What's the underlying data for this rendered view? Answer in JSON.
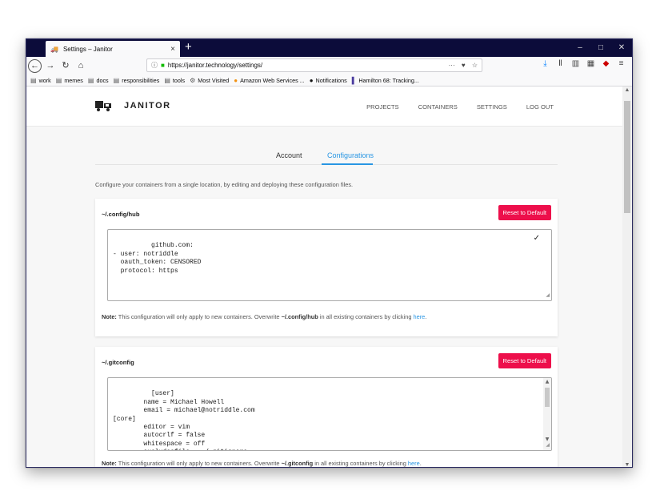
{
  "browser": {
    "tab_title": "Settings – Janitor",
    "tab_close": "×",
    "new_tab": "+",
    "window_controls": [
      "–",
      "□",
      "✕"
    ],
    "url": "https://janitor.technology/settings/",
    "url_actions": [
      "···",
      "♥",
      "☆"
    ],
    "bookmarks": [
      {
        "label": "work",
        "icon": "folder-icon"
      },
      {
        "label": "memes",
        "icon": "folder-icon"
      },
      {
        "label": "docs",
        "icon": "folder-icon"
      },
      {
        "label": "responsibilities",
        "icon": "folder-icon"
      },
      {
        "label": "tools",
        "icon": "folder-icon"
      },
      {
        "label": "Most Visited",
        "icon": "gear-icon"
      },
      {
        "label": "Amazon Web Services ...",
        "icon": "amazon-icon"
      },
      {
        "label": "Notifications",
        "icon": "github-icon"
      },
      {
        "label": "Hamilton 68: Tracking...",
        "icon": "hamilton-icon"
      }
    ]
  },
  "app": {
    "brand": "JANITOR",
    "nav": [
      "PROJECTS",
      "CONTAINERS",
      "SETTINGS",
      "LOG OUT"
    ]
  },
  "settings": {
    "tabs": [
      "Account",
      "Configurations"
    ],
    "active_tab": "Configurations",
    "intro": "Configure your containers from a single location, by editing and deploying these configuration files."
  },
  "configs": [
    {
      "title": "~/.config/hub",
      "reset_label": "Reset to Default",
      "content": "github.com:\n- user: notriddle\n  oauth_token: CENSORED\n  protocol: https",
      "note_prefix": "Note:",
      "note_text": " This configuration will only apply to new containers. Overwrite ",
      "note_path": "~/.config/hub",
      "note_suffix": " in all existing containers by clicking ",
      "note_link": "here",
      "note_end": "."
    },
    {
      "title": "~/.gitconfig",
      "reset_label": "Reset to Default",
      "content": "[user]\n        name = Michael Howell\n        email = michael@notriddle.com\n[core]\n        editor = vim\n        autocrlf = false\n        whitespace = off\n        excludesfile = ~/.gitignore",
      "note_prefix": "Note:",
      "note_text": " This configuration will only apply to new containers. Overwrite ",
      "note_path": "~/.gitconfig",
      "note_suffix": " in all existing containers by clicking ",
      "note_link": "here",
      "note_end": "."
    }
  ],
  "colors": {
    "accent": "#2996e3",
    "reset_button": "#ed0f4b",
    "titlebar": "#0c0c3a"
  }
}
